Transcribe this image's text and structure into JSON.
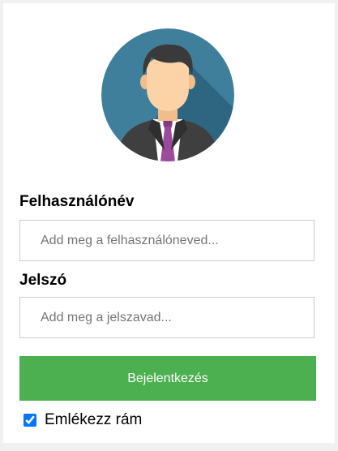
{
  "avatar": {
    "icon": "user-avatar-icon",
    "colors": {
      "background": "#3f7f9b",
      "shadow": "#2e6580",
      "skin": "#fbd3a6",
      "hair": "#3a3a3a",
      "suit": "#3f3f3f",
      "shirt": "#ffffff",
      "tie": "#9b4a9c"
    }
  },
  "form": {
    "username_label": "Felhasználónév",
    "username_placeholder": "Add meg a felhasználóneved...",
    "username_value": "",
    "password_label": "Jelszó",
    "password_placeholder": "Add meg a jelszavad...",
    "password_value": "",
    "submit_label": "Bejelentkezés",
    "remember_label": "Emlékezz rám",
    "remember_checked": true
  },
  "colors": {
    "accent": "#4caf50",
    "checkbox": "#0075ff"
  }
}
